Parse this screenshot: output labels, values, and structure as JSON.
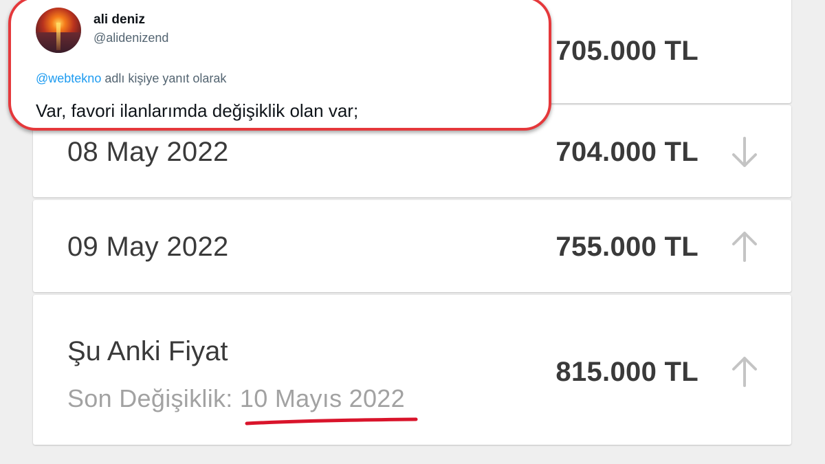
{
  "tweet": {
    "name": "ali deniz",
    "handle": "@alidenizend",
    "reply_mention": "@webtekno",
    "reply_suffix": " adlı kişiye yanıt olarak",
    "text": "Var, favori ilanlarımda değişiklik olan var;"
  },
  "price_history": [
    {
      "date": "",
      "price": "705.000 TL",
      "trend": "none"
    },
    {
      "date": "08 May 2022",
      "price": "704.000 TL",
      "trend": "down"
    },
    {
      "date": "09 May 2022",
      "price": "755.000 TL",
      "trend": "up"
    }
  ],
  "current": {
    "title": "Şu Anki Fiyat",
    "last_change_label": "Son Değişiklik:",
    "last_change_date": "10 Mayıs 2022",
    "price": "815.000 TL",
    "trend": "up"
  },
  "colors": {
    "highlight": "#d9142b",
    "text": "#3a3a3a",
    "muted": "#a2a2a2",
    "arrow": "#c4c4c4",
    "tweet_border": "#e5383b",
    "mention": "#1d9bf0"
  }
}
